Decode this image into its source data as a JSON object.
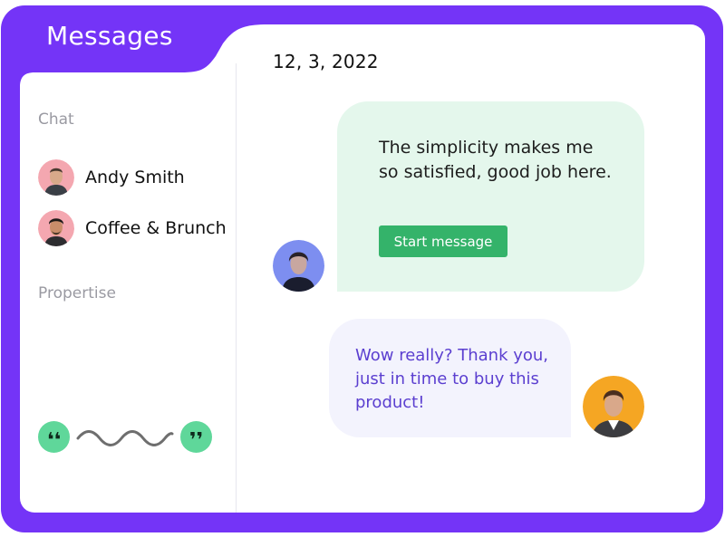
{
  "header": {
    "title": "Messages"
  },
  "conversation": {
    "date": "12, 3, 2022"
  },
  "sidebar": {
    "chat_label": "Chat",
    "chats": [
      {
        "name": "Andy Smith"
      },
      {
        "name": "Coffee & Brunch"
      }
    ],
    "propertise_label": "Propertise"
  },
  "messages": {
    "incoming": {
      "text": "The simplicity makes me so satisfied, good job here.",
      "button_label": "Start message"
    },
    "outgoing": {
      "text": "Wow really? Thank you, just in time to buy this product!"
    }
  },
  "decor": {
    "open_quote": "❛❛",
    "close_quote": "❜❜"
  },
  "colors": {
    "frame": "#7434f7",
    "incoming_bubble": "#e4f7ec",
    "outgoing_bubble": "#f3f3fd",
    "button": "#34b36a",
    "outgoing_text": "#5b3fd0",
    "quote_dot": "#5fd79a"
  }
}
